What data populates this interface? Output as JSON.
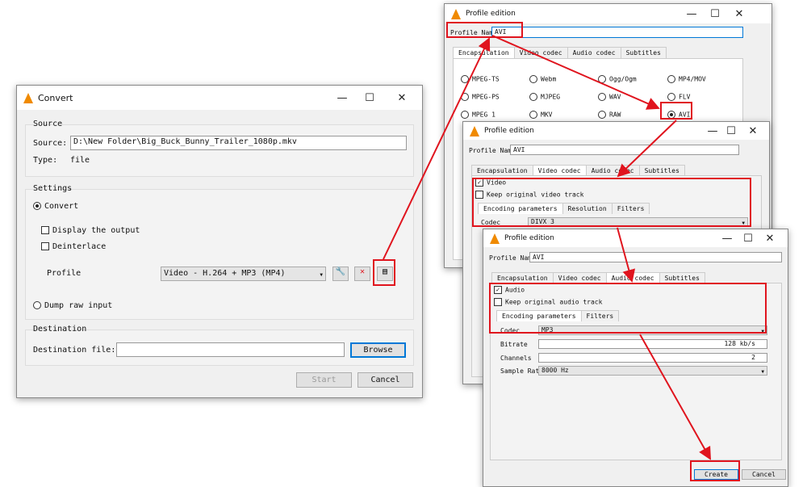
{
  "convert": {
    "title": "Convert",
    "source_group": "Source",
    "source_label": "Source:",
    "source_value": "D:\\New Folder\\Big_Buck_Bunny_Trailer_1080p.mkv",
    "type_label": "Type:",
    "type_value": "file",
    "settings_group": "Settings",
    "convert_label": "Convert",
    "display_output": "Display the output",
    "deinterlace": "Deinterlace",
    "profile_label": "Profile",
    "profile_value": "Video - H.264 + MP3 (MP4)",
    "dump_raw": "Dump raw input",
    "destination_group": "Destination",
    "dest_label": "Destination file:",
    "dest_value": "",
    "browse": "Browse",
    "start": "Start",
    "cancel": "Cancel"
  },
  "pe1": {
    "title": "Profile edition",
    "name_label": "Profile Name",
    "name_value": "AVI",
    "tabs": [
      "Encapsulation",
      "Video codec",
      "Audio codec",
      "Subtitles"
    ],
    "formats": [
      "MPEG-TS",
      "Webm",
      "Ogg/Ogm",
      "MP4/MOV",
      "MPEG-PS",
      "MJPEG",
      "WAV",
      "FLV",
      "MPEG 1",
      "MKV",
      "RAW",
      "AVI"
    ],
    "selected": "AVI"
  },
  "pe2": {
    "title": "Profile edition",
    "name_label": "Profile Name",
    "name_value": "AVI",
    "tabs": [
      "Encapsulation",
      "Video codec",
      "Audio codec",
      "Subtitles"
    ],
    "video": "Video",
    "keep": "Keep original video track",
    "subtabs": [
      "Encoding parameters",
      "Resolution",
      "Filters"
    ],
    "codec_label": "Codec",
    "codec_value": "DIVX 3"
  },
  "pe3": {
    "title": "Profile edition",
    "name_label": "Profile Name",
    "name_value": "AVI",
    "tabs": [
      "Encapsulation",
      "Video codec",
      "Audio codec",
      "Subtitles"
    ],
    "audio": "Audio",
    "keep": "Keep original audio track",
    "subtabs": [
      "Encoding parameters",
      "Filters"
    ],
    "codec_label": "Codec",
    "codec_value": "MP3",
    "bitrate_label": "Bitrate",
    "bitrate_value": "128 kb/s",
    "channels_label": "Channels",
    "channels_value": "2",
    "samplerate_label": "Sample Rate",
    "samplerate_value": "8000 Hz",
    "create": "Create",
    "cancel": "Cancel"
  },
  "colors": {
    "annotation": "#e0141e",
    "vlc_orange": "#f08a00"
  }
}
